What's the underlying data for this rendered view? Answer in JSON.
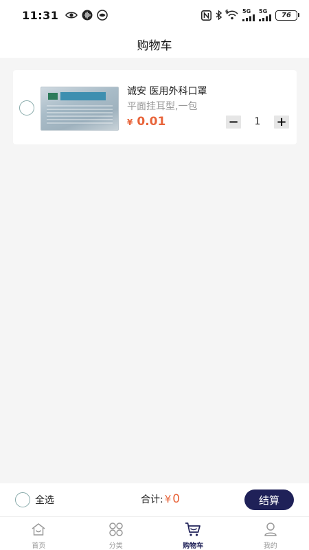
{
  "status_bar": {
    "time": "11:31",
    "network_1": "5G",
    "network_2": "5G",
    "wifi_badge": "6",
    "battery": "76"
  },
  "header": {
    "title": "购物车"
  },
  "cart": {
    "items": [
      {
        "title": "诚安 医用外科口罩",
        "spec": "平面挂耳型,一包",
        "currency": "¥",
        "price": "0.01",
        "quantity": "1",
        "decrease_label": "−",
        "increase_label": "+",
        "image_icon": "mask-package-image"
      }
    ]
  },
  "checkout": {
    "select_all_label": "全选",
    "total_label": "合计:",
    "total_currency": "¥",
    "total_amount": "0",
    "checkout_label": "结算",
    "accent_color": "#1f2158",
    "price_color": "#e8643a"
  },
  "tabs": [
    {
      "label": "首页",
      "icon": "home-icon",
      "active": false
    },
    {
      "label": "分类",
      "icon": "category-icon",
      "active": false
    },
    {
      "label": "购物车",
      "icon": "cart-icon",
      "active": true
    },
    {
      "label": "我的",
      "icon": "profile-icon",
      "active": false
    }
  ]
}
